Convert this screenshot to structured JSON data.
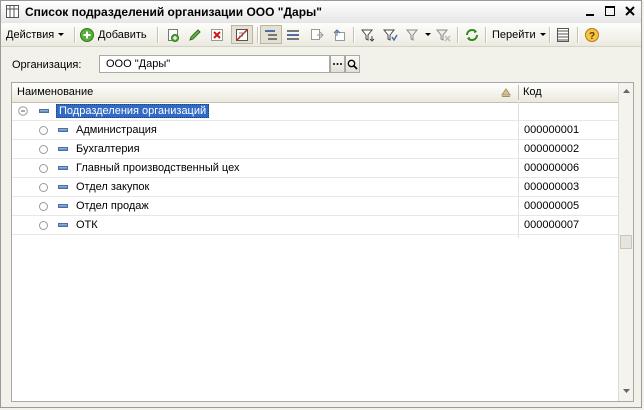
{
  "window": {
    "title": "Список подразделений организации ООО \"Дары\"",
    "icon": "list-icon",
    "controls": [
      "minimize-icon",
      "maximize-icon",
      "close-icon"
    ]
  },
  "toolbar": {
    "actions_label": "Действия",
    "add_label": "Добавить",
    "goto_label": "Перейти",
    "icons": [
      "add-copy-icon",
      "edit-icon",
      "delete-icon",
      "mark-delete-icon",
      "tree-mode-icon",
      "list-mode-icon",
      "move-to-group-icon",
      "level-up-icon",
      "filter-icon",
      "filter-set-icon",
      "filter-list-icon",
      "filter-clear-icon",
      "refresh-icon",
      "columns-settings-icon",
      "help-icon"
    ]
  },
  "org": {
    "label": "Организация:",
    "value": "ООО \"Дары\""
  },
  "grid": {
    "columns": [
      "Наименование",
      "Код"
    ],
    "group": {
      "name": "Подразделения организаций",
      "code": ""
    },
    "rows": [
      {
        "name": "Администрация",
        "code": "000000001"
      },
      {
        "name": "Бухгалтерия",
        "code": "000000002"
      },
      {
        "name": "Главный производственный цех",
        "code": "000000006"
      },
      {
        "name": "Отдел закупок",
        "code": "000000003"
      },
      {
        "name": "Отдел продаж",
        "code": "000000005"
      },
      {
        "name": "ОТК",
        "code": "000000007"
      }
    ]
  },
  "colors": {
    "selection": "#316ac5",
    "window_bg": "#f2f1ea",
    "item_icon": "#5f86c0"
  }
}
